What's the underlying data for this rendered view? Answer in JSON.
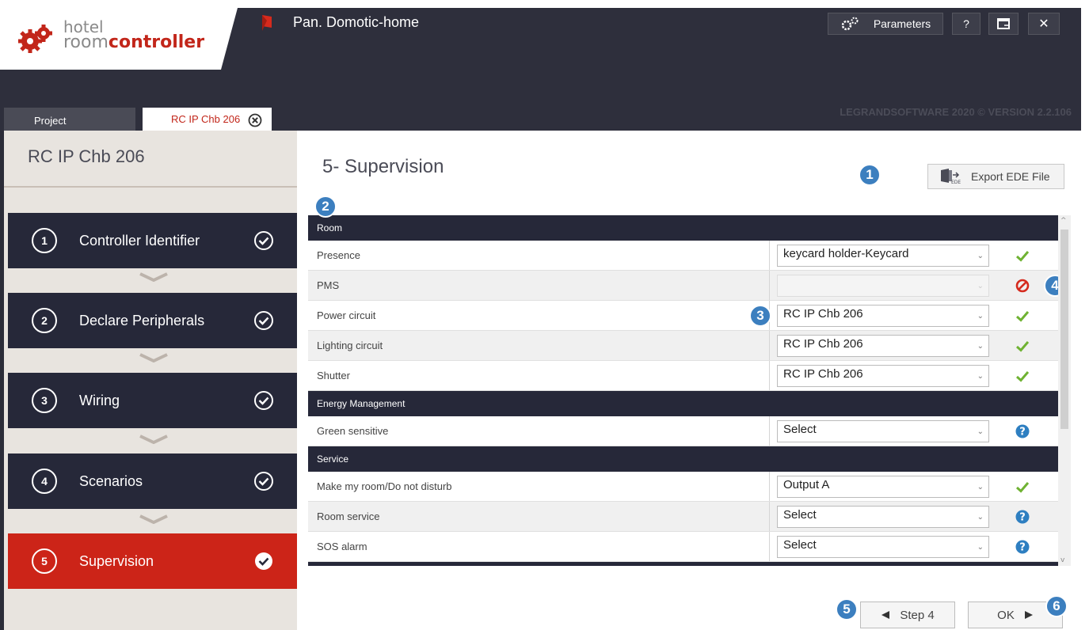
{
  "app": {
    "title": "Pan. Domotic-home",
    "logo_line1": "hotel",
    "logo_line2_light": "room",
    "logo_line2_bold": "controller",
    "version": "LEGRANDSOFTWARE 2020 © VERSION 2.2.106"
  },
  "header_buttons": {
    "parameters": "Parameters",
    "help": "?",
    "close": "✕"
  },
  "tabs": {
    "project": "Project",
    "active": "RC IP Chb 206"
  },
  "sidebar": {
    "title": "RC IP Chb 206",
    "steps": [
      {
        "num": "1",
        "label": "Controller Identifier"
      },
      {
        "num": "2",
        "label": "Declare Peripherals"
      },
      {
        "num": "3",
        "label": "Wiring"
      },
      {
        "num": "4",
        "label": "Scenarios"
      },
      {
        "num": "5",
        "label": "Supervision"
      }
    ]
  },
  "main": {
    "title": "5- Supervision",
    "export_label": "Export EDE File",
    "prev_label": "Step 4",
    "ok_label": "OK"
  },
  "badges": [
    "1",
    "2",
    "3",
    "4",
    "5",
    "6"
  ],
  "sections": {
    "room": "Room",
    "energy": "Energy Management",
    "service": "Service"
  },
  "rows": [
    {
      "label": "Presence",
      "value": "keycard holder-Keycard",
      "status": "check"
    },
    {
      "label": "PMS",
      "value": "",
      "status": "forbidden"
    },
    {
      "label": "Power circuit",
      "value": "RC IP Chb 206",
      "status": "check"
    },
    {
      "label": "Lighting circuit",
      "value": "RC IP Chb 206",
      "status": "check"
    },
    {
      "label": "Shutter",
      "value": "RC IP Chb 206",
      "status": "check"
    },
    {
      "label": "Green sensitive",
      "value": "Select",
      "status": "help"
    },
    {
      "label": "Make my room/Do not disturb",
      "value": "Output A",
      "status": "check"
    },
    {
      "label": "Room service",
      "value": "Select",
      "status": "help"
    },
    {
      "label": "SOS alarm",
      "value": "Select",
      "status": "help"
    }
  ],
  "colors": {
    "accent_red": "#cc2418",
    "dark_navy": "#262839",
    "badge_blue": "#3c7fbf",
    "check_green": "#6fb232"
  }
}
